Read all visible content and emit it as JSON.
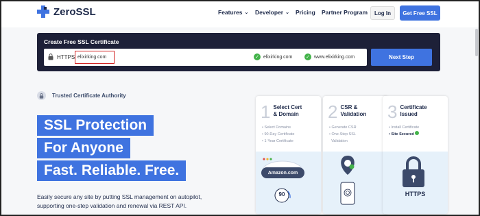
{
  "brand": {
    "name": "ZeroSSL"
  },
  "nav": {
    "features": "Features",
    "developer": "Developer",
    "pricing": "Pricing",
    "partner": "Partner Program",
    "login": "Log In",
    "get_free": "Get Free SSL"
  },
  "create": {
    "title": "Create Free SSL Certificate",
    "protocol": "HTTPS",
    "domain_value": "elixirking.com",
    "option1": "elixirking.com",
    "option2": "www.elixirking.com",
    "next": "Next Step"
  },
  "hero": {
    "trusted": "Trusted Certificate Authority",
    "line1": "SSL Protection",
    "line2": "For Anyone",
    "line3": "Fast. Reliable. Free.",
    "desc1": "Easily secure any site by putting SSL management on autopilot,",
    "desc2": "supporting one-step validation and renewal via REST API."
  },
  "cards": [
    {
      "num": "1",
      "title1": "Select Cert",
      "title2": "& Domain",
      "items": [
        "Select Domains",
        "90-Day Certificate",
        "1-Year Certificate"
      ]
    },
    {
      "num": "2",
      "title1": "CSR &",
      "title2": "Validation",
      "items": [
        "Generate CSR",
        "One-Step SSL",
        "Validation"
      ]
    },
    {
      "num": "3",
      "title1": "Certificate",
      "title2": "Issued",
      "items": [
        "Install Certificate",
        "Site Secured"
      ]
    }
  ],
  "illustrations": {
    "amazon": "Amazon.com",
    "days": "90",
    "https": "HTTPS"
  },
  "colors": {
    "accent": "#3f73e0",
    "panel": "#1d2038",
    "check": "#43b34a",
    "highlight": "#d21f1f"
  }
}
